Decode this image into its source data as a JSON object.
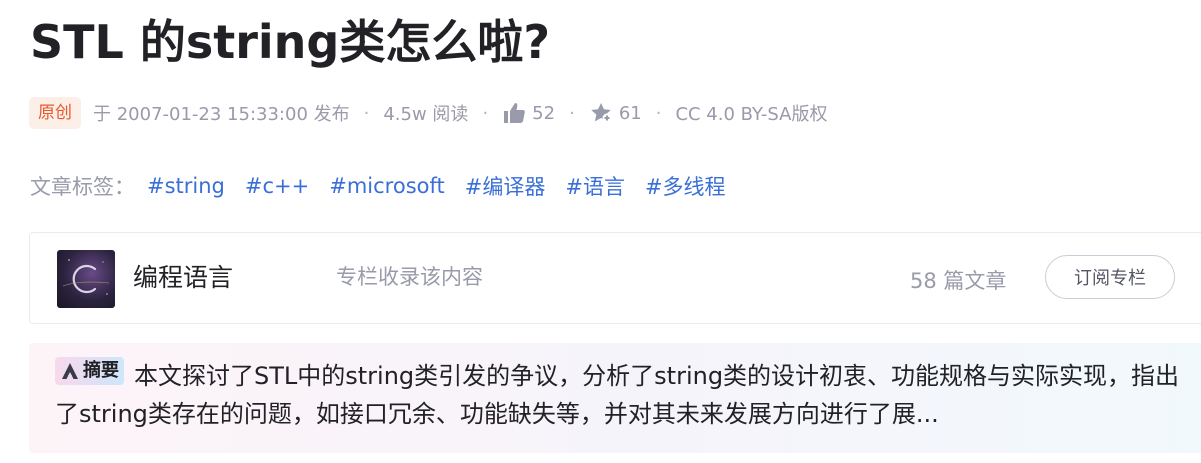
{
  "article": {
    "title": "STL 的string类怎么啦?",
    "badge": "原创",
    "publish": "于 2007-01-23 15:33:00 发布",
    "separator": "·",
    "views": "4.5w 阅读",
    "likes": "52",
    "favorites": "61",
    "license": "CC 4.0 BY-SA版权"
  },
  "tags": {
    "label": "文章标签：",
    "items": [
      "#string",
      "#c++",
      "#microsoft",
      "#编译器",
      "#语言",
      "#多线程"
    ]
  },
  "column": {
    "name": "编程语言",
    "description": "专栏收录该内容",
    "count": "58 篇文章",
    "subscribe_label": "订阅专栏"
  },
  "abstract": {
    "badge": "摘要",
    "text": "本文探讨了STL中的string类引发的争议，分析了string类的设计初衷、功能规格与实际实现，指出了string类存在的问题，如接口冗余、功能缺失等，并对其未来发展方向进行了展..."
  },
  "icons": {
    "like": "thumbs-up-icon",
    "favorite": "star-collect-icon",
    "abstract": "ai-abstract-icon"
  },
  "colors": {
    "accent_orange": "#e8592b",
    "badge_bg": "#fcefe8",
    "tag_blue": "#3a6fd8",
    "muted_text": "#999aaa"
  }
}
